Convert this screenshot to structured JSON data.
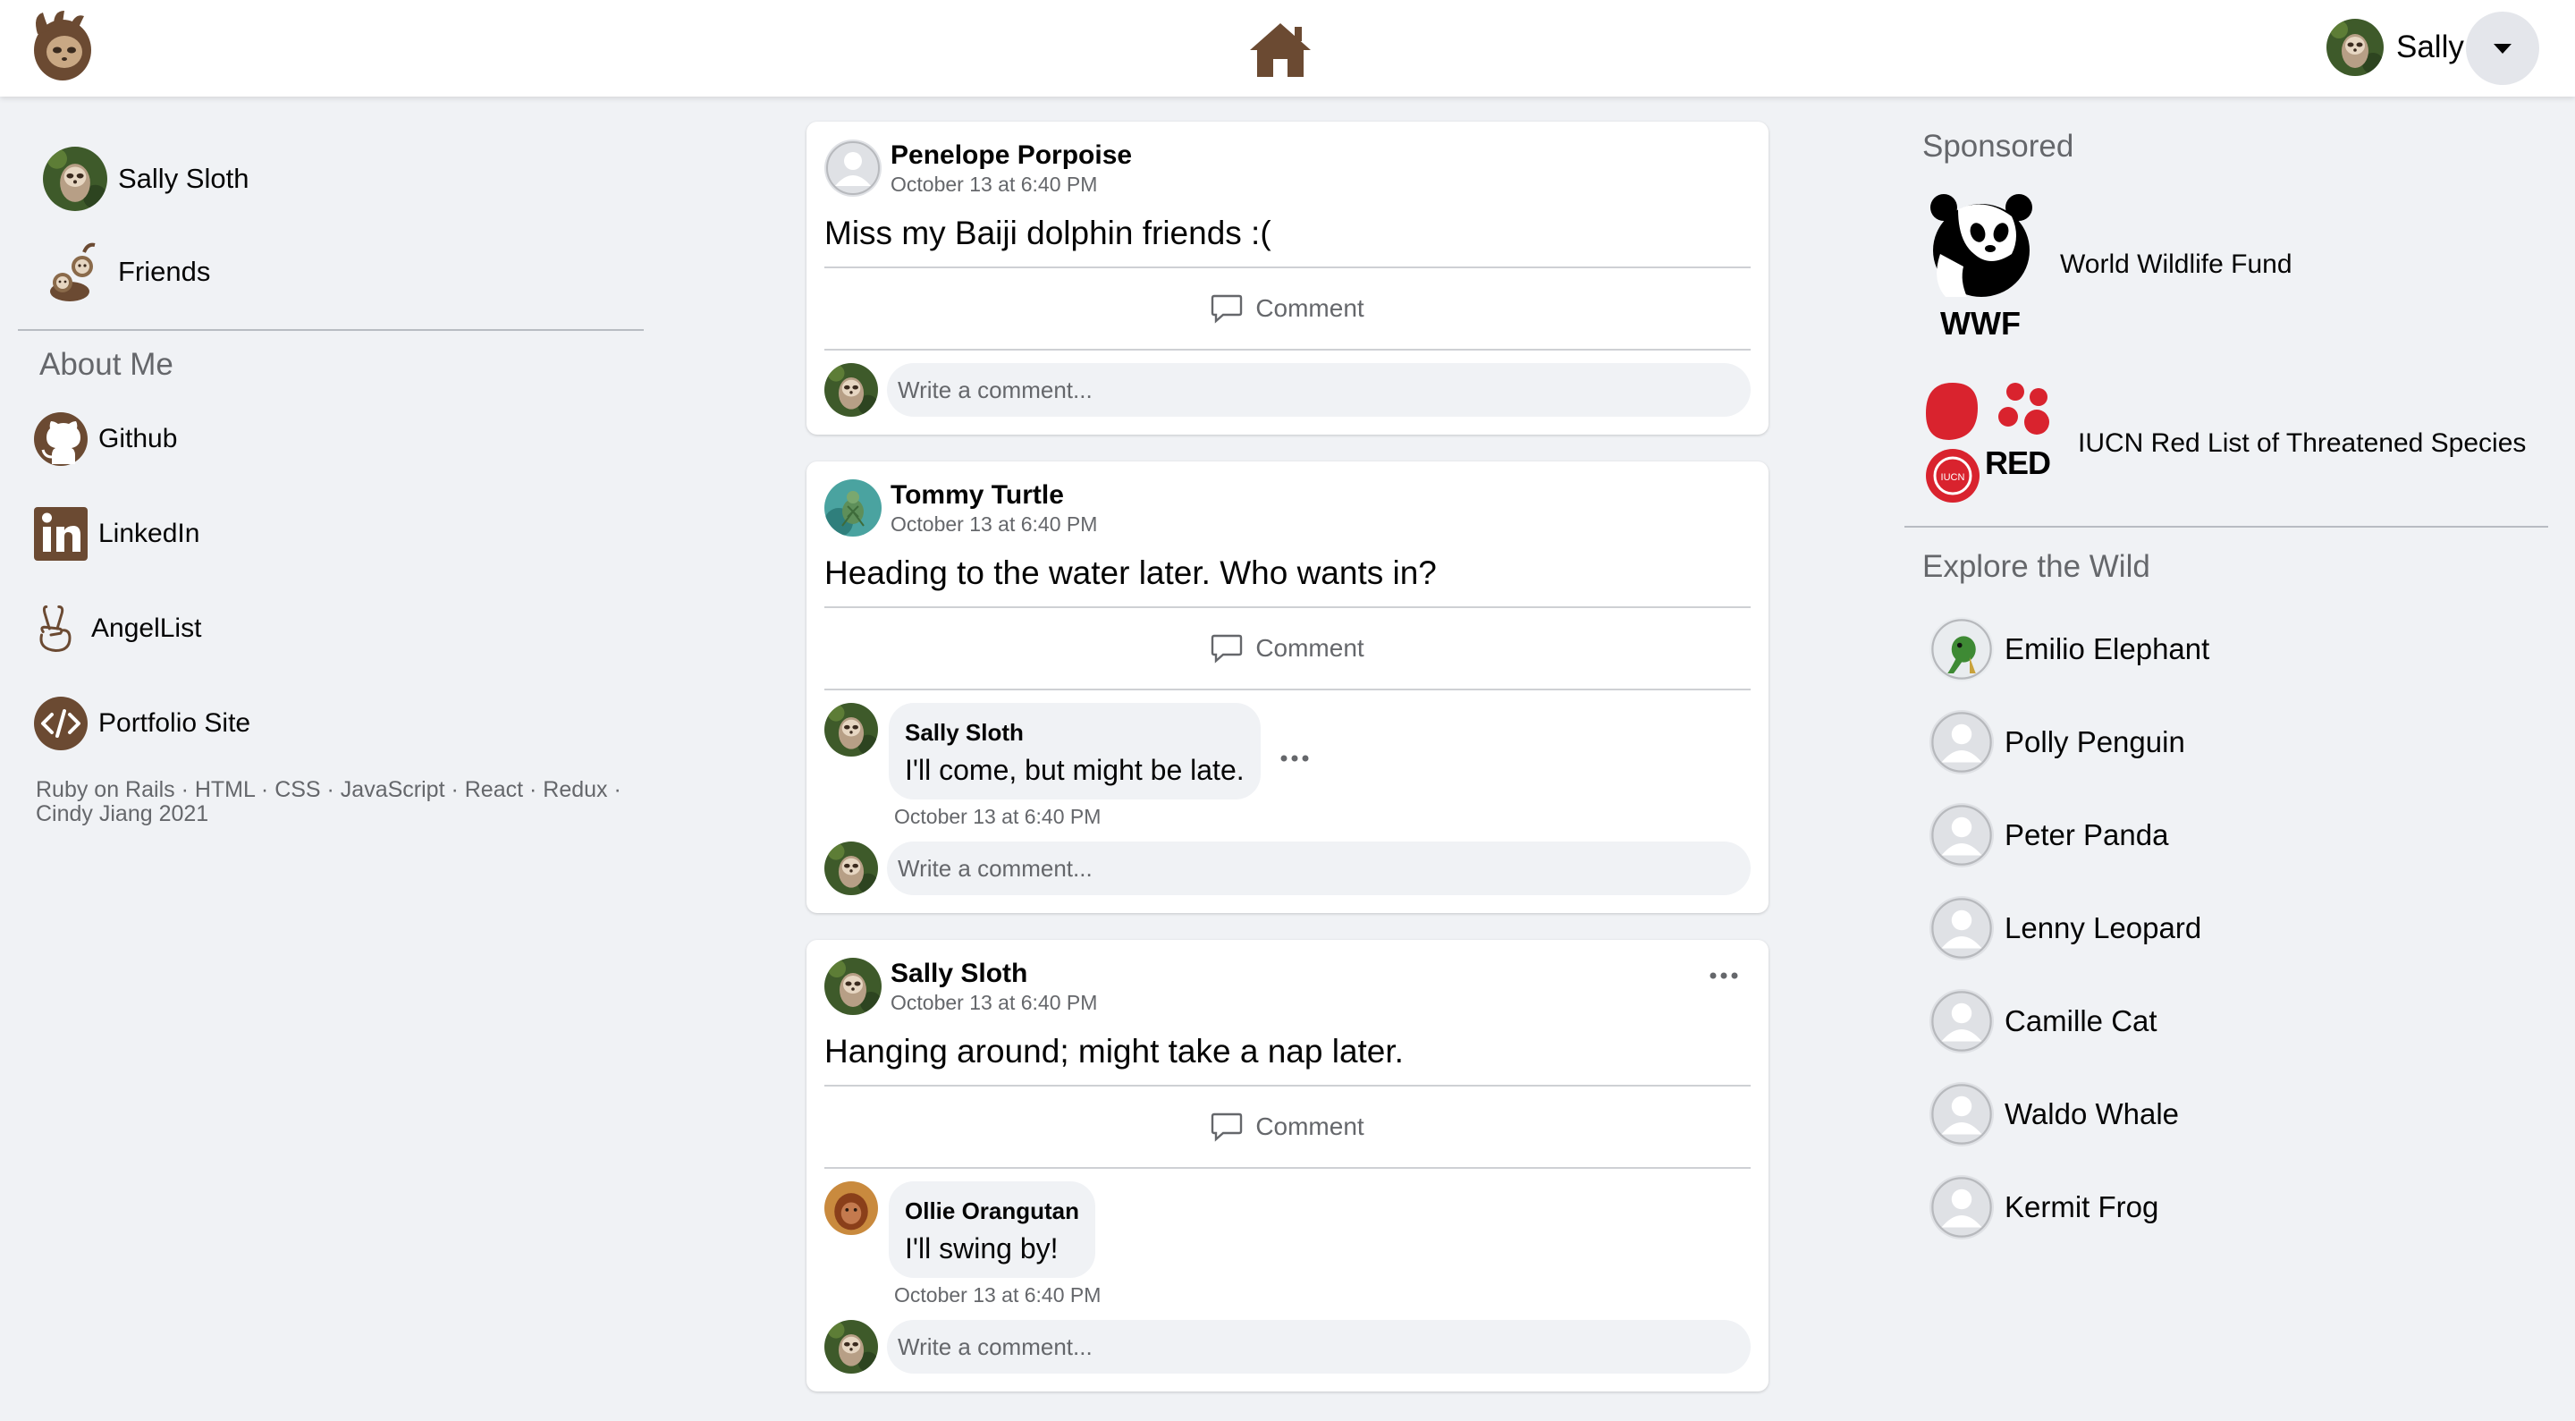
{
  "nav": {
    "user_name": "Sally"
  },
  "left": {
    "profile_name": "Sally Sloth",
    "friends_label": "Friends",
    "about_title": "About Me",
    "links": [
      {
        "label": "Github",
        "icon": "github-icon"
      },
      {
        "label": "LinkedIn",
        "icon": "linkedin-icon"
      },
      {
        "label": "AngelList",
        "icon": "angellist-icon"
      },
      {
        "label": "Portfolio Site",
        "icon": "code-icon"
      }
    ],
    "tech": "Ruby on Rails · HTML · CSS · JavaScript · React · Redux · Cindy Jiang 2021"
  },
  "posts": [
    {
      "author": "Penelope Porpoise",
      "time": "October 13 at 6:40 PM",
      "body": "Miss my Baiji dolphin friends :(",
      "comment_label": "Comment",
      "placeholder": "Write a comment..."
    },
    {
      "author": "Tommy Turtle",
      "time": "October 13 at 6:40 PM",
      "body": "Heading to the water later. Who wants in?",
      "comment_label": "Comment",
      "comments": [
        {
          "author": "Sally Sloth",
          "text": "I'll come, but might be late.",
          "time": "October 13 at 6:40 PM"
        }
      ],
      "placeholder": "Write a comment..."
    },
    {
      "author": "Sally Sloth",
      "time": "October 13 at 6:40 PM",
      "body": "Hanging around; might take a nap later.",
      "comment_label": "Comment",
      "comments": [
        {
          "author": "Ollie Orangutan",
          "text": "I'll swing by!",
          "time": "October 13 at 6:40 PM"
        }
      ],
      "placeholder": "Write a comment..."
    }
  ],
  "right": {
    "sponsored_title": "Sponsored",
    "sponsors": [
      {
        "name": "World Wildlife Fund",
        "logo_text": "WWF"
      },
      {
        "name": "IUCN Red List of Threatened Species",
        "logo_text": "RED LIST"
      }
    ],
    "explore_title": "Explore the Wild",
    "friends": [
      "Emilio Elephant",
      "Polly Penguin",
      "Peter Panda",
      "Lenny Leopard",
      "Camille Cat",
      "Waldo Whale",
      "Kermit Frog"
    ]
  },
  "colors": {
    "brand_brown": "#6b4a32",
    "background": "#f0f2f5",
    "iucn_red": "#d9232e"
  }
}
